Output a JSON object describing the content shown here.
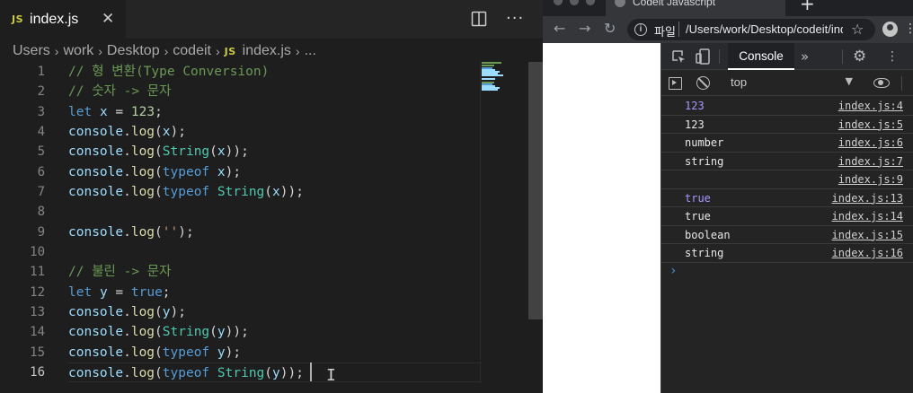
{
  "editor": {
    "tab_icon": "JS",
    "tab_title": "index.js",
    "tab_close": "✕",
    "more_actions": "···",
    "breadcrumb": [
      "Users",
      "work",
      "Desktop",
      "codeit",
      "index.js",
      "..."
    ],
    "breadcrumb_file_icon": "JS",
    "line_numbers": [
      "1",
      "2",
      "3",
      "4",
      "5",
      "6",
      "7",
      "8",
      "9",
      "10",
      "11",
      "12",
      "13",
      "14",
      "15",
      "16"
    ],
    "lines": [
      [
        [
          "cmt",
          "// 형 변환(Type Conversion)"
        ]
      ],
      [
        [
          "cmt",
          "// 숫자 -> 문자"
        ]
      ],
      [
        [
          "kw",
          "let"
        ],
        [
          "txt",
          " "
        ],
        [
          "var",
          "x"
        ],
        [
          "txt",
          " = "
        ],
        [
          "num",
          "123"
        ],
        [
          "txt",
          ";"
        ]
      ],
      [
        [
          "var",
          "console"
        ],
        [
          "txt",
          "."
        ],
        [
          "fn",
          "log"
        ],
        [
          "txt",
          "("
        ],
        [
          "var",
          "x"
        ],
        [
          "txt",
          ");"
        ]
      ],
      [
        [
          "var",
          "console"
        ],
        [
          "txt",
          "."
        ],
        [
          "fn",
          "log"
        ],
        [
          "txt",
          "("
        ],
        [
          "cls",
          "String"
        ],
        [
          "txt",
          "("
        ],
        [
          "var",
          "x"
        ],
        [
          "txt",
          "));"
        ]
      ],
      [
        [
          "var",
          "console"
        ],
        [
          "txt",
          "."
        ],
        [
          "fn",
          "log"
        ],
        [
          "txt",
          "("
        ],
        [
          "kw",
          "typeof"
        ],
        [
          "txt",
          " "
        ],
        [
          "var",
          "x"
        ],
        [
          "txt",
          ");"
        ]
      ],
      [
        [
          "var",
          "console"
        ],
        [
          "txt",
          "."
        ],
        [
          "fn",
          "log"
        ],
        [
          "txt",
          "("
        ],
        [
          "kw",
          "typeof"
        ],
        [
          "txt",
          " "
        ],
        [
          "cls",
          "String"
        ],
        [
          "txt",
          "("
        ],
        [
          "var",
          "x"
        ],
        [
          "txt",
          "));"
        ]
      ],
      [],
      [
        [
          "var",
          "console"
        ],
        [
          "txt",
          "."
        ],
        [
          "fn",
          "log"
        ],
        [
          "txt",
          "("
        ],
        [
          "str",
          "''"
        ],
        [
          "txt",
          ");"
        ]
      ],
      [],
      [
        [
          "cmt",
          "// 불린 -> 문자"
        ]
      ],
      [
        [
          "kw",
          "let"
        ],
        [
          "txt",
          " "
        ],
        [
          "var",
          "y"
        ],
        [
          "txt",
          " = "
        ],
        [
          "kw",
          "true"
        ],
        [
          "txt",
          ";"
        ]
      ],
      [
        [
          "var",
          "console"
        ],
        [
          "txt",
          "."
        ],
        [
          "fn",
          "log"
        ],
        [
          "txt",
          "("
        ],
        [
          "var",
          "y"
        ],
        [
          "txt",
          ");"
        ]
      ],
      [
        [
          "var",
          "console"
        ],
        [
          "txt",
          "."
        ],
        [
          "fn",
          "log"
        ],
        [
          "txt",
          "("
        ],
        [
          "cls",
          "String"
        ],
        [
          "txt",
          "("
        ],
        [
          "var",
          "y"
        ],
        [
          "txt",
          "));"
        ]
      ],
      [
        [
          "var",
          "console"
        ],
        [
          "txt",
          "."
        ],
        [
          "fn",
          "log"
        ],
        [
          "txt",
          "("
        ],
        [
          "kw",
          "typeof"
        ],
        [
          "txt",
          " "
        ],
        [
          "var",
          "y"
        ],
        [
          "txt",
          ");"
        ]
      ],
      [
        [
          "var",
          "console"
        ],
        [
          "txt",
          "."
        ],
        [
          "fn",
          "log"
        ],
        [
          "txt",
          "("
        ],
        [
          "kw",
          "typeof"
        ],
        [
          "txt",
          " "
        ],
        [
          "cls",
          "String"
        ],
        [
          "txt",
          "("
        ],
        [
          "var",
          "y"
        ],
        [
          "txt",
          "));"
        ]
      ]
    ],
    "colors": {
      "background": "#1e1e1e",
      "comment": "#6a9955",
      "keyword": "#569cd6",
      "variable": "#9cdcfe",
      "number": "#b5cea8",
      "function": "#dcdcaa",
      "class": "#4ec9b0",
      "string": "#ce9178"
    }
  },
  "browser": {
    "tab_title": "Codeit Javascript",
    "new_tab": "+",
    "back": "←",
    "forward": "→",
    "reload": "↻",
    "info": "i",
    "scheme": "파일",
    "url": "/Users/work/Desktop/codeit/index.html",
    "star": "☆",
    "menu": "⋮"
  },
  "devtools": {
    "active_tab": "Console",
    "more_tabs": "»",
    "settings": "⚙",
    "menu": "⋮",
    "context": "top",
    "context_arrow": "▼",
    "messages": [
      {
        "text": "123",
        "source": "index.js:4",
        "kind": "num"
      },
      {
        "text": "123",
        "source": "index.js:5",
        "kind": "plain"
      },
      {
        "text": "number",
        "source": "index.js:6",
        "kind": "plain"
      },
      {
        "text": "string",
        "source": "index.js:7",
        "kind": "plain"
      },
      {
        "text": "",
        "source": "index.js:9",
        "kind": "plain"
      },
      {
        "text": "true",
        "source": "index.js:13",
        "kind": "bool"
      },
      {
        "text": "true",
        "source": "index.js:14",
        "kind": "plain"
      },
      {
        "text": "boolean",
        "source": "index.js:15",
        "kind": "plain"
      },
      {
        "text": "string",
        "source": "index.js:16",
        "kind": "plain"
      }
    ],
    "prompt": "›"
  }
}
